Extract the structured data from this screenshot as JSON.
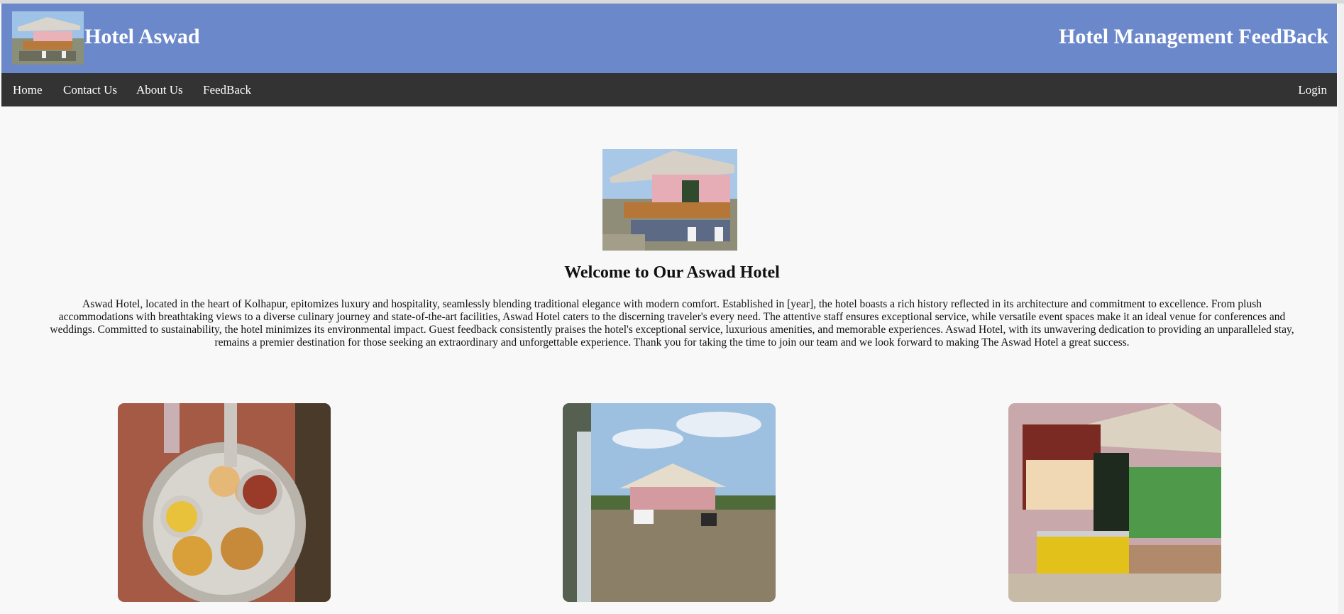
{
  "header": {
    "brand": "Hotel Aswad",
    "right_title": "Hotel Management FeedBack",
    "logo_icon": "hotel-photo-icon",
    "background_color": "#6b88cb"
  },
  "nav": {
    "items": [
      {
        "label": "Home"
      },
      {
        "label": "Contact Us"
      },
      {
        "label": "About Us"
      },
      {
        "label": "FeedBack"
      }
    ],
    "login_label": "Login",
    "background_color": "#333333"
  },
  "main": {
    "welcome_title": "Welcome to Our Aswad Hotel",
    "about_text": "Aswad Hotel, located in the heart of Kolhapur, epitomizes luxury and hospitality, seamlessly blending traditional elegance with modern comfort. Established in [year], the hotel boasts a rich history reflected in its architecture and commitment to excellence. From plush accommodations with breathtaking views to a diverse culinary journey and state-of-the-art facilities, Aswad Hotel caters to the discerning traveler's every need. The attentive staff ensures exceptional service, while versatile event spaces make it an ideal venue for conferences and weddings. Committed to sustainability, the hotel minimizes its environmental impact. Guest feedback consistently praises the hotel's exceptional service, luxurious amenities, and memorable experiences. Aswad Hotel, with its unwavering dedication to providing an unparalleled stay, remains a premier destination for those seeking an extraordinary and unforgettable experience. Thank you for taking the time to join our team and we look forward to making The Aswad Hotel a great success."
  },
  "gallery": {
    "images": [
      {
        "icon": "food-thali-photo-icon"
      },
      {
        "icon": "hotel-exterior-photo-icon"
      },
      {
        "icon": "hotel-counter-photo-icon"
      }
    ]
  }
}
